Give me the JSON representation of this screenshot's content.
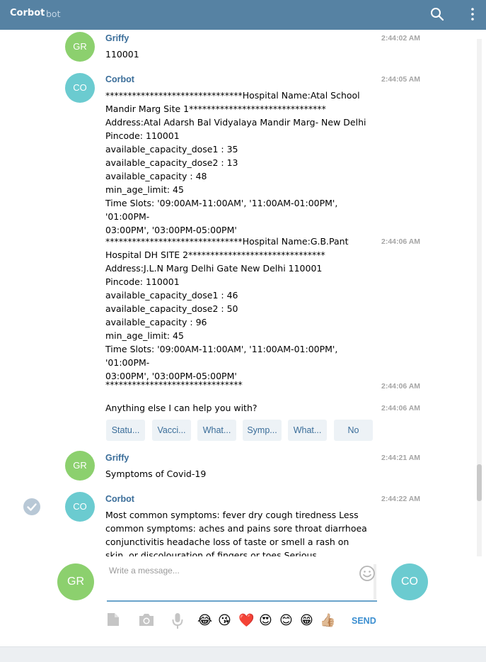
{
  "header": {
    "title": "Corbot",
    "subtitle": "bot"
  },
  "messages": [
    {
      "author": "Griffy",
      "avatar": "GR",
      "time": "2:44:02 AM",
      "text": "110001"
    },
    {
      "author": "Corbot",
      "avatar": "CO",
      "time": "2:44:05 AM",
      "text": "*******************************Hospital Name:Atal School\nMandir Marg Site 1*******************************\nAddress:Atal Adarsh Bal Vidyalaya Mandir Marg- New Delhi\nPincode: 110001\navailable_capacity_dose1 : 35\navailable_capacity_dose2 : 13\navailable_capacity : 48\nmin_age_limit: 45\nTime Slots: '09:00AM-11:00AM', '11:00AM-01:00PM', '01:00PM-\n03:00PM', '03:00PM-05:00PM'"
    },
    {
      "time": "2:44:06 AM",
      "text": "*******************************Hospital Name:G.B.Pant\nHospital DH SITE 2*******************************\nAddress:J.L.N Marg Delhi Gate New Delhi 110001\nPincode: 110001\navailable_capacity_dose1 : 46\navailable_capacity_dose2 : 50\navailable_capacity : 96\nmin_age_limit: 45\nTime Slots: '09:00AM-11:00AM', '11:00AM-01:00PM', '01:00PM-\n03:00PM', '03:00PM-05:00PM'"
    },
    {
      "time": "2:44:06 AM",
      "text": "*******************************"
    },
    {
      "time": "2:44:06 AM",
      "text": "Anything else I can help you with?"
    },
    {
      "author": "Griffy",
      "avatar": "GR",
      "time": "2:44:21 AM",
      "text": "Symptoms of Covid-19"
    },
    {
      "author": "Corbot",
      "avatar": "CO",
      "time": "2:44:22 AM",
      "text": "Most common symptoms: fever dry cough tiredness Less common symptoms: aches and pains sore throat diarrhoea conjunctivitis headache loss of taste or smell a rash on skin, or discolouration of fingers or toes Serious symptoms: difficulty breathing or"
    }
  ],
  "keyboard": [
    "Statu...",
    "Vacci...",
    "What...",
    "Symp...",
    "What...",
    "No"
  ],
  "composer": {
    "placeholder": "Write a message...",
    "user_avatar": "GR",
    "bot_avatar": "CO",
    "send_label": "SEND"
  },
  "tools": [
    "attach-file-icon",
    "camera-icon",
    "microphone-icon"
  ],
  "emojis": [
    "😂",
    "😘",
    "❤️",
    "😍",
    "😊",
    "😁",
    "👍🏼"
  ],
  "colors": {
    "header": "#5682a3",
    "author": "#3a6d99",
    "avatar_user": "#8cd06e",
    "avatar_bot": "#6bcbd0",
    "send": "#3a8ed0"
  }
}
